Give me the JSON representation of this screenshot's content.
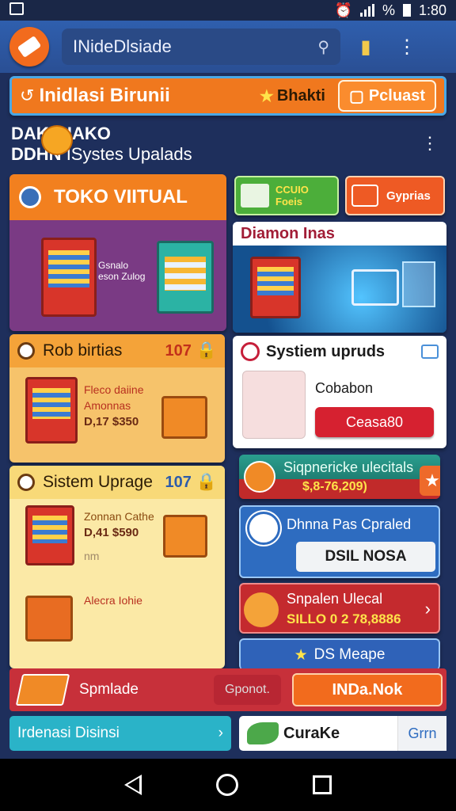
{
  "status_bar": {
    "time": "1:80",
    "battery_label": "%"
  },
  "app_bar": {
    "search_text": "INideDlsiade",
    "search_icon": "pin-icon",
    "actions": [
      "trash-icon",
      "more-vert-icon"
    ]
  },
  "banner": {
    "title": "Inidlasi Birunii",
    "chip_label": "Bhakti",
    "button_label": "Pcluast"
  },
  "header": {
    "line1": "DAKO IAKO",
    "line2_prefix": "DDHN",
    "line2": "ISystes Upalads"
  },
  "cards": {
    "toko": {
      "title": "TOKO VIITUAL",
      "caption": [
        "Gsnalo",
        "eson Zulog"
      ]
    },
    "rob": {
      "title": "Rob birtias",
      "count": "107",
      "desc": [
        "Fleco daiine",
        "Amonnas"
      ],
      "price": "D,17 $350"
    },
    "sistem": {
      "title": "Sistem Uprage",
      "count": "107",
      "desc": [
        "Zonnan Cathe"
      ],
      "price": "D,41 $590",
      "extra": "nm",
      "desc2": "Alecra Iohie"
    },
    "green": {
      "label": [
        "CCUIO",
        "Foeis"
      ]
    },
    "orange": {
      "label": "Gyprias"
    },
    "diamon": {
      "title": "Diamon Inas"
    },
    "sysup": {
      "title": "Systiem upruds",
      "label": "Cobabon",
      "button": "Ceasa80"
    },
    "teal": {
      "line1": "Siqpnericke ulecitals",
      "line2": "$,8-76,209)"
    },
    "blue": {
      "title": "Dhnna Pas Cpraled",
      "input_value": "DSIL NOSA"
    },
    "red": {
      "line1": "Snpalen Ulecal",
      "line2": "SILLO 0 2 78,8886"
    },
    "map": {
      "label": "DS Meape"
    }
  },
  "bottom": {
    "red_label": "Spmlade",
    "ghost_label": "Gponot.",
    "cta_label": "INDa.Nok",
    "teal_label": "Irdenasi Disinsi",
    "white_label": "CuraKe",
    "white_sub": "Grrn"
  }
}
